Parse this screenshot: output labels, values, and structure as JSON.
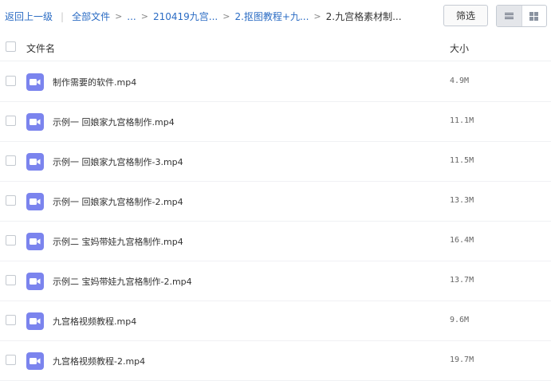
{
  "breadcrumb": {
    "back": "返回上一级",
    "divider": "|",
    "all_files": "全部文件",
    "sep": ">",
    "ellipsis": "...",
    "crumb1": "210419九宫...",
    "crumb2": "2.抠图教程+九...",
    "crumb3": "2.九宫格素材制..."
  },
  "toolbar": {
    "filter_label": "筛选",
    "view_modes": [
      "list-view-icon",
      "grid-view-icon"
    ],
    "active_view": "list"
  },
  "table": {
    "col_name": "文件名",
    "col_size": "大小"
  },
  "files": [
    {
      "name": "制作需要的软件.mp4",
      "size": "4.9M"
    },
    {
      "name": "示例一 回娘家九宫格制作.mp4",
      "size": "11.1M"
    },
    {
      "name": "示例一 回娘家九宫格制作-3.mp4",
      "size": "11.5M"
    },
    {
      "name": "示例一 回娘家九宫格制作-2.mp4",
      "size": "13.3M"
    },
    {
      "name": "示例二 宝妈带娃九宫格制作.mp4",
      "size": "16.4M"
    },
    {
      "name": "示例二 宝妈带娃九宫格制作-2.mp4",
      "size": "13.7M"
    },
    {
      "name": "九宫格视频教程.mp4",
      "size": "9.6M"
    },
    {
      "name": "九宫格视频教程-2.mp4",
      "size": "19.7M"
    }
  ],
  "icon": "video-file-icon",
  "colors": {
    "link": "#2b6cc4",
    "video_icon": "#7b84ee",
    "active_view_bg": "#e4e6ea"
  }
}
